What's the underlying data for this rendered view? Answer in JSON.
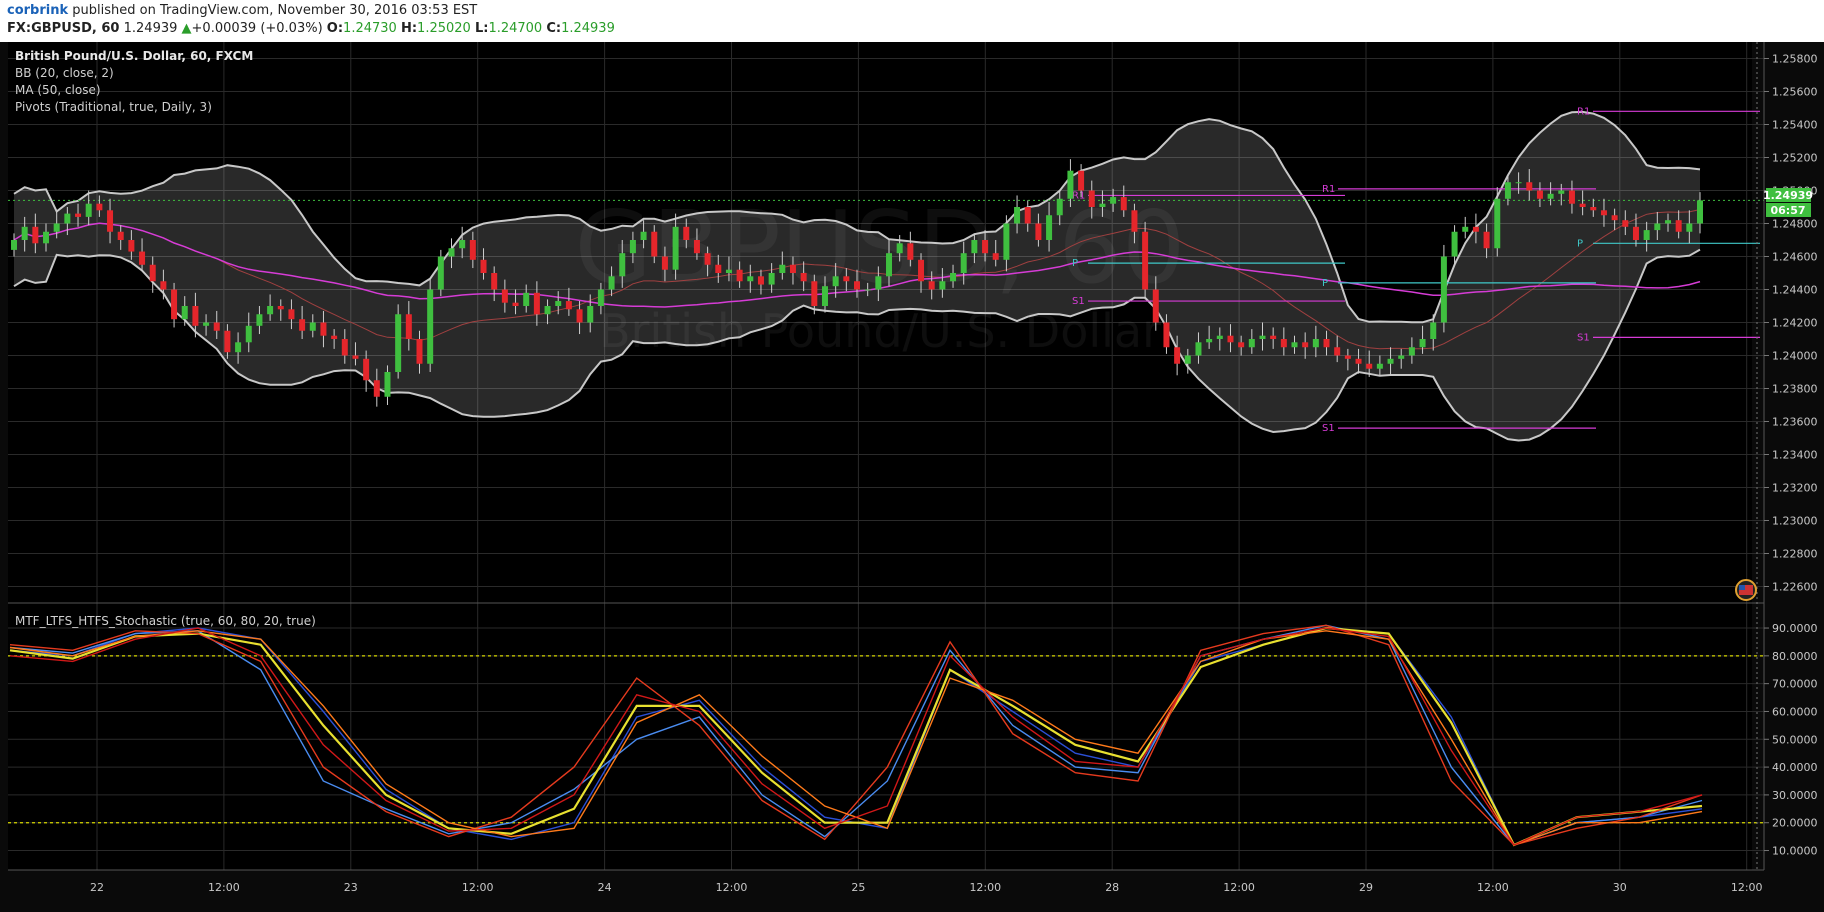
{
  "header": {
    "user": "corbrink",
    "published_text": "published on TradingView.com, November 30, 2016 03:53 EST",
    "symbol": "FX:GBPUSD, 60",
    "last": "1.24939",
    "arrow": "▲",
    "change": "+0.00039 (+0.03%)",
    "o_label": "O:",
    "o": "1.24730",
    "h_label": "H:",
    "h": "1.25020",
    "l_label": "L:",
    "l": "1.24700",
    "c_label": "C:",
    "c": "1.24939"
  },
  "legend": {
    "title": "British Pound/U.S. Dollar, 60, FXCM",
    "bb": "BB (20, close, 2)",
    "ma": "MA (50, close)",
    "pivots": "Pivots (Traditional, true, Daily, 3)",
    "stoch": "MTF_LTFS_HTFS_Stochastic (true, 60, 80, 20, true)"
  },
  "watermark": {
    "symbol": "GBPUSD, 60",
    "name": "British Pound/U.S. Dollar"
  },
  "last_price_badge": "1.24939",
  "countdown_badge": "06:57",
  "colors": {
    "bg": "#000000",
    "up": "#3fbf3f",
    "down": "#e5262b",
    "bb": "#c8c8c8",
    "ma": "#d63cd6",
    "pivot_p": "#3fc8c8",
    "pivot_rs": "#d63cd6",
    "stoch_level": "#d8d800"
  },
  "chart_data": [
    {
      "type": "candlestick",
      "title": "British Pound/U.S. Dollar, 60, FXCM",
      "x_ticks": [
        "22",
        "12:00",
        "23",
        "12:00",
        "24",
        "12:00",
        "25",
        "12:00",
        "28",
        "12:00",
        "29",
        "12:00",
        "30",
        "12:00"
      ],
      "y_ticks": [
        "1.25800",
        "1.25600",
        "1.25400",
        "1.25200",
        "1.25000",
        "1.24800",
        "1.24600",
        "1.24400",
        "1.24200",
        "1.24000",
        "1.23800",
        "1.23600",
        "1.23400",
        "1.23200",
        "1.23000",
        "1.22800",
        "1.22600"
      ],
      "ylim": [
        1.225,
        1.259
      ],
      "close_series": [
        1.247,
        1.2478,
        1.2468,
        1.2475,
        1.248,
        1.2486,
        1.2484,
        1.2492,
        1.2488,
        1.2475,
        1.247,
        1.2463,
        1.2455,
        1.2445,
        1.244,
        1.2422,
        1.243,
        1.2418,
        1.242,
        1.2415,
        1.2402,
        1.2408,
        1.2418,
        1.2425,
        1.243,
        1.2428,
        1.2422,
        1.2415,
        1.242,
        1.2412,
        1.241,
        1.24,
        1.2398,
        1.2385,
        1.2375,
        1.239,
        1.2425,
        1.241,
        1.2395,
        1.244,
        1.246,
        1.2465,
        1.247,
        1.2458,
        1.245,
        1.244,
        1.2432,
        1.243,
        1.2438,
        1.2425,
        1.243,
        1.2433,
        1.2428,
        1.242,
        1.243,
        1.244,
        1.2448,
        1.2462,
        1.247,
        1.2475,
        1.246,
        1.2452,
        1.2478,
        1.247,
        1.2462,
        1.2455,
        1.245,
        1.2452,
        1.2445,
        1.2448,
        1.2443,
        1.245,
        1.2455,
        1.245,
        1.2445,
        1.243,
        1.2442,
        1.2448,
        1.2445,
        1.244,
        1.244,
        1.2448,
        1.2462,
        1.2468,
        1.2458,
        1.2445,
        1.244,
        1.2445,
        1.245,
        1.2462,
        1.247,
        1.2462,
        1.2458,
        1.248,
        1.249,
        1.248,
        1.247,
        1.2485,
        1.2495,
        1.2512,
        1.25,
        1.249,
        1.2492,
        1.2496,
        1.2488,
        1.2475,
        1.244,
        1.242,
        1.2405,
        1.2395,
        1.24,
        1.2408,
        1.241,
        1.2412,
        1.2408,
        1.2405,
        1.241,
        1.2412,
        1.241,
        1.2405,
        1.2408,
        1.2405,
        1.241,
        1.2405,
        1.24,
        1.2398,
        1.2395,
        1.2392,
        1.2395,
        1.2398,
        1.24,
        1.2405,
        1.241,
        1.242,
        1.246,
        1.2475,
        1.2478,
        1.2475,
        1.2465,
        1.2495,
        1.2505,
        1.2505,
        1.25,
        1.2495,
        1.2498,
        1.25,
        1.2492,
        1.249,
        1.2488,
        1.2485,
        1.2482,
        1.2478,
        1.247,
        1.2476,
        1.248,
        1.2482,
        1.2475,
        1.248,
        1.2494
      ],
      "pivots": {
        "day1": {
          "R1": 1.2497,
          "P": 1.2456,
          "S1": 1.2433
        },
        "day2": {
          "R1": 1.2501,
          "P": 1.2444,
          "S1": 1.2356
        },
        "day3": {
          "R1": 1.2548,
          "P": 1.2468,
          "S1": 1.2411
        }
      }
    },
    {
      "type": "line",
      "title": "MTF_LTFS_HTFS_Stochastic (true, 60, 80, 20, true)",
      "y_ticks": [
        "90.0000",
        "80.0000",
        "70.0000",
        "60.0000",
        "50.0000",
        "40.0000",
        "30.0000",
        "20.0000",
        "10.0000"
      ],
      "ylim": [
        3,
        99
      ],
      "levels": [
        80,
        20
      ],
      "x": [
        0,
        6,
        12,
        18,
        24,
        30,
        36,
        42,
        48,
        54,
        60,
        66,
        72,
        78,
        84,
        90,
        96,
        102,
        108,
        114,
        120,
        126,
        132,
        138,
        144,
        150,
        156,
        162
      ],
      "series": [
        {
          "values": [
            82,
            80,
            88,
            90,
            86,
            60,
            32,
            18,
            14,
            20,
            58,
            64,
            40,
            22,
            18,
            75,
            60,
            45,
            40,
            78,
            84,
            90,
            88,
            58,
            12,
            20,
            22,
            25
          ]
        },
        {
          "values": [
            83,
            81,
            88,
            89,
            75,
            35,
            25,
            16,
            20,
            32,
            50,
            58,
            30,
            15,
            35,
            82,
            55,
            40,
            38,
            80,
            86,
            91,
            86,
            40,
            12,
            20,
            22,
            28
          ]
        },
        {
          "values": [
            82,
            79,
            87,
            88,
            84,
            55,
            30,
            18,
            16,
            25,
            62,
            62,
            38,
            20,
            20,
            75,
            62,
            48,
            42,
            76,
            84,
            90,
            88,
            56,
            12,
            22,
            24,
            26
          ]
        },
        {
          "values": [
            84,
            82,
            89,
            88,
            78,
            40,
            24,
            15,
            22,
            40,
            72,
            55,
            28,
            14,
            40,
            85,
            52,
            38,
            35,
            82,
            88,
            91,
            84,
            35,
            12,
            18,
            22,
            30
          ]
        },
        {
          "values": [
            83,
            80,
            87,
            89,
            86,
            62,
            34,
            20,
            15,
            18,
            56,
            66,
            44,
            26,
            18,
            72,
            64,
            50,
            45,
            78,
            86,
            89,
            86,
            50,
            12,
            20,
            20,
            24
          ]
        },
        {
          "values": [
            80,
            78,
            86,
            90,
            80,
            48,
            28,
            17,
            18,
            30,
            66,
            60,
            34,
            18,
            26,
            80,
            58,
            42,
            40,
            80,
            86,
            90,
            87,
            46,
            12,
            22,
            24,
            30
          ]
        }
      ]
    }
  ]
}
